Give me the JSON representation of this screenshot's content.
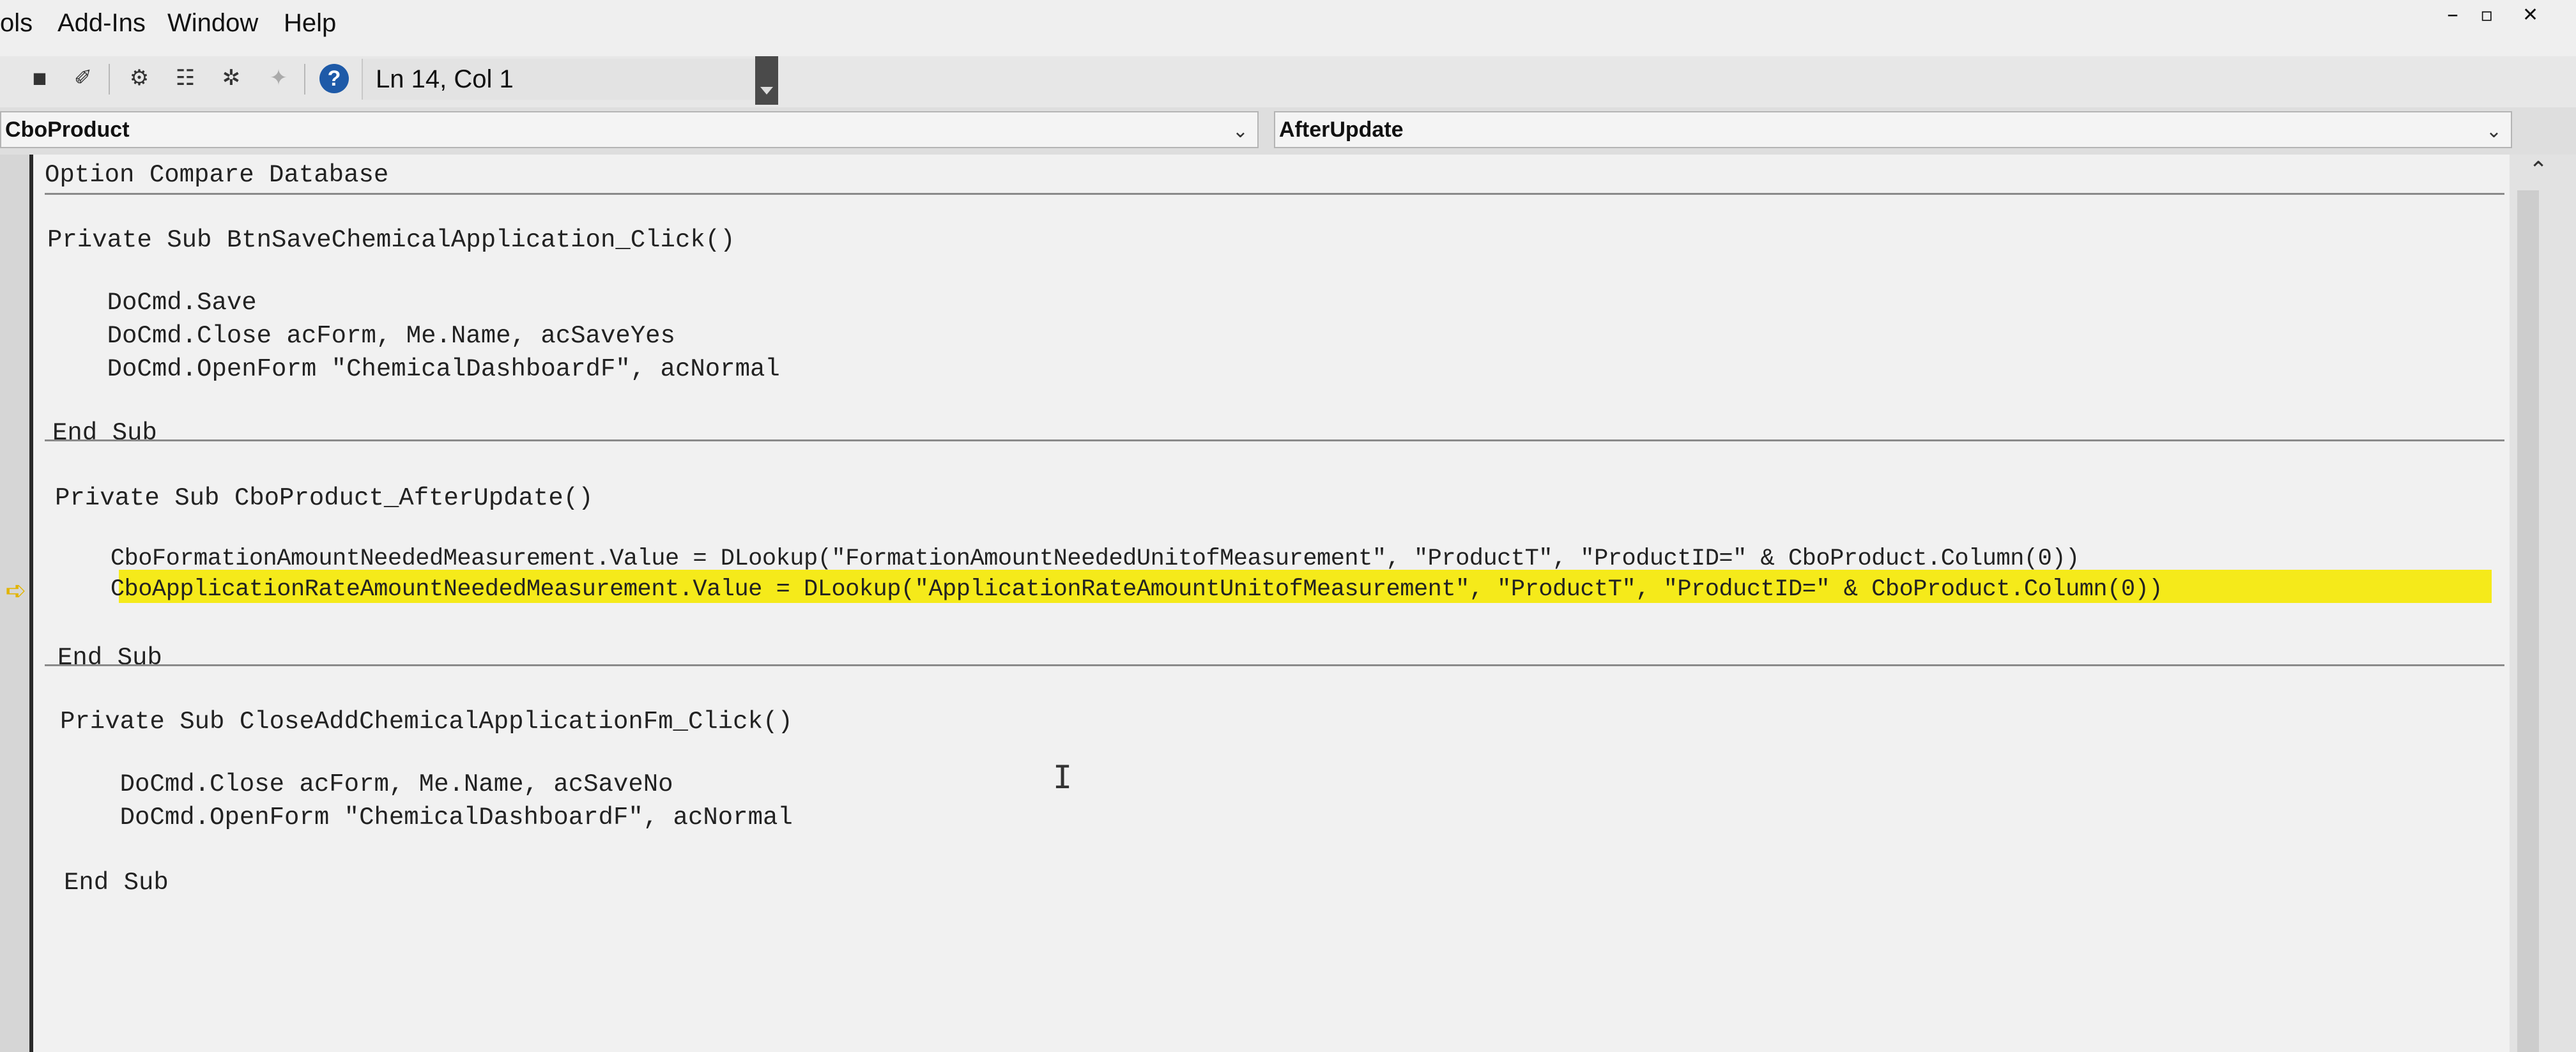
{
  "menu": {
    "items": [
      "ols",
      "Add-Ins",
      "Window",
      "Help"
    ]
  },
  "window_controls": {
    "minimize": "–",
    "restore": "▫",
    "close": "✕"
  },
  "toolbar": {
    "status": "Ln 14, Col 1"
  },
  "combos": {
    "object": "CboProduct",
    "procedure": "AfterUpdate"
  },
  "code": {
    "lines": [
      "Option Compare Database",
      "Private Sub BtnSaveChemicalApplication_Click()",
      "    DoCmd.Save",
      "    DoCmd.Close acForm, Me.Name, acSaveYes",
      "    DoCmd.OpenForm \"ChemicalDashboardF\", acNormal",
      "End Sub",
      "Private Sub CboProduct_AfterUpdate()",
      "    CboFormationAmountNeededMeasurement.Value = DLookup(\"FormationAmountNeededUnitofMeasurement\", \"ProductT\", \"ProductID=\" & CboProduct.Column(0))",
      "    CboApplicationRateAmountNeededMeasurement.Value = DLookup(\"ApplicationRateAmountUnitofMeasurement\", \"ProductT\", \"ProductID=\" & CboProduct.Column(0))",
      "End Sub",
      "Private Sub CloseAddChemicalApplicationFm_Click()",
      "    DoCmd.Close acForm, Me.Name, acSaveNo",
      "    DoCmd.OpenForm \"ChemicalDashboardF\", acNormal",
      "End Sub"
    ]
  },
  "colors": {
    "highlight": "#f5ea1a",
    "execution_arrow": "#e2b400",
    "help_icon": "#1e5aa8"
  }
}
